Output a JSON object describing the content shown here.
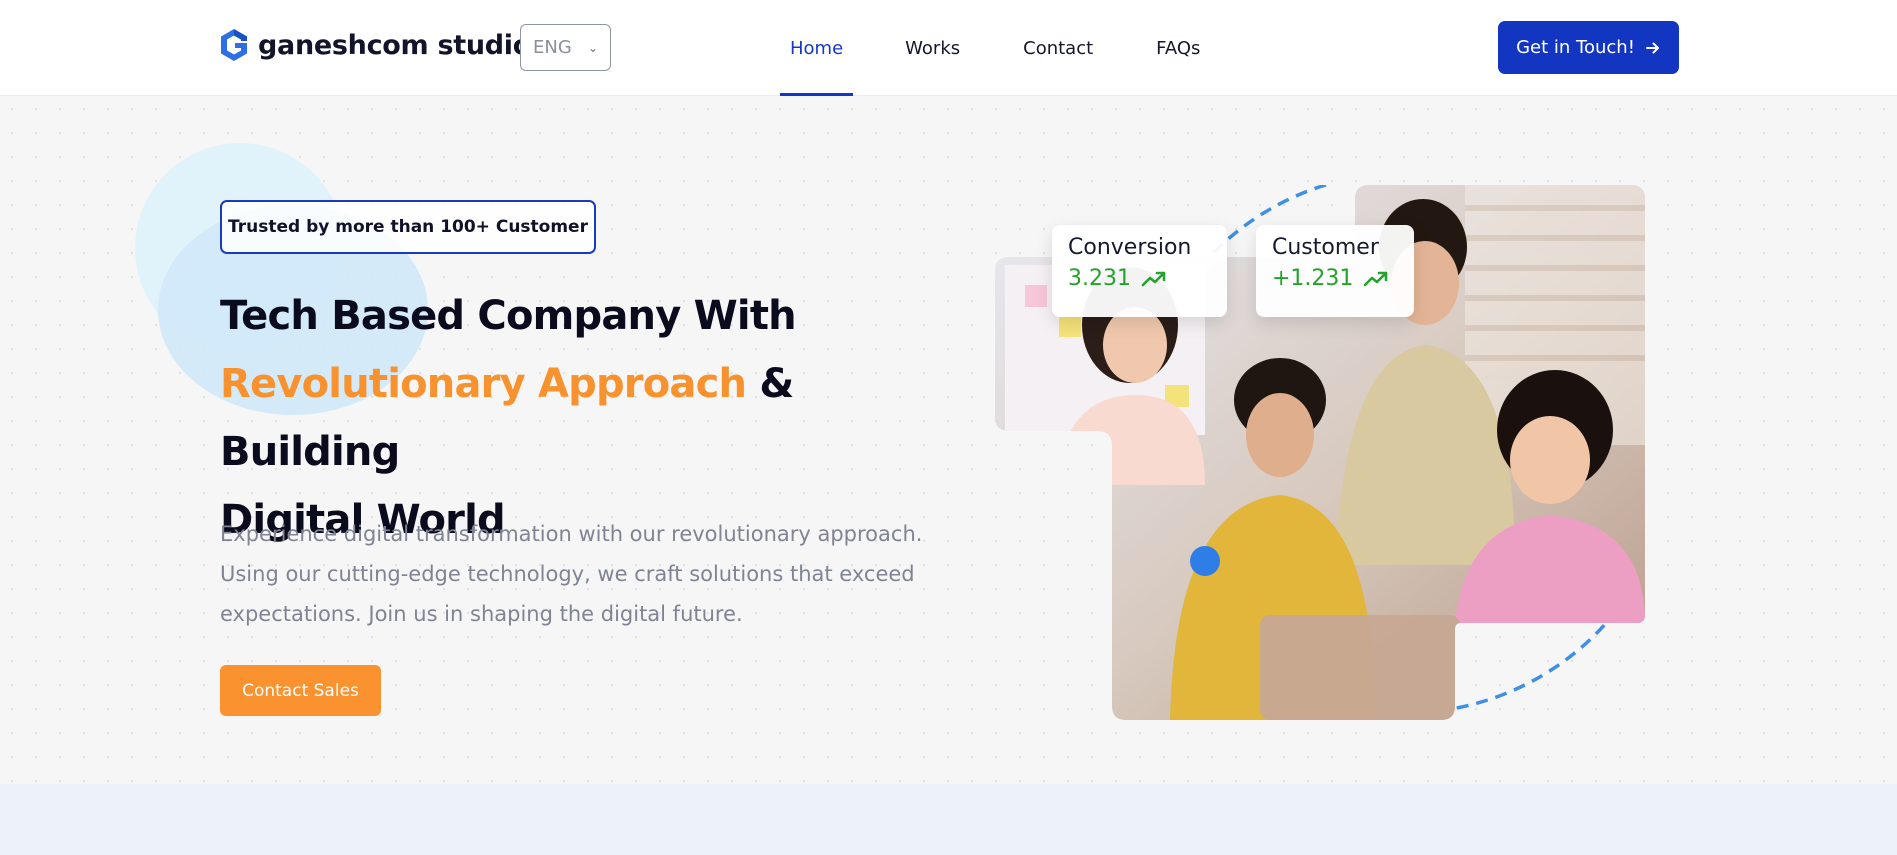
{
  "header": {
    "brand": "ganeshcom studio",
    "language": "ENG",
    "nav": [
      {
        "label": "Home",
        "active": true
      },
      {
        "label": "Works",
        "active": false
      },
      {
        "label": "Contact",
        "active": false
      },
      {
        "label": "FAQs",
        "active": false
      }
    ],
    "cta_label": "Get in Touch!"
  },
  "hero": {
    "badge": "Trusted by more than 100+ Customer",
    "headline_part1": "Tech Based Company With",
    "headline_accent": "Revolutionary Approach",
    "headline_part2": "& Building",
    "headline_part3": "Digital World",
    "description": "Experience digital transformation with our revolutionary approach. Using our cutting-edge technology, we craft solutions that exceed expectations. Join us in shaping the digital future.",
    "contact_label": "Contact Sales"
  },
  "stats": [
    {
      "label": "Conversion",
      "value": "3.231"
    },
    {
      "label": "Customer",
      "value": "+1.231"
    }
  ],
  "colors": {
    "primary": "#1236c2",
    "accent": "#f9922f",
    "positive": "#23a32b"
  },
  "icons": {
    "logo": "logo-mark-icon",
    "dropdown": "chevron-down-icon",
    "cta": "arrow-right-icon",
    "trend": "trend-up-icon"
  }
}
